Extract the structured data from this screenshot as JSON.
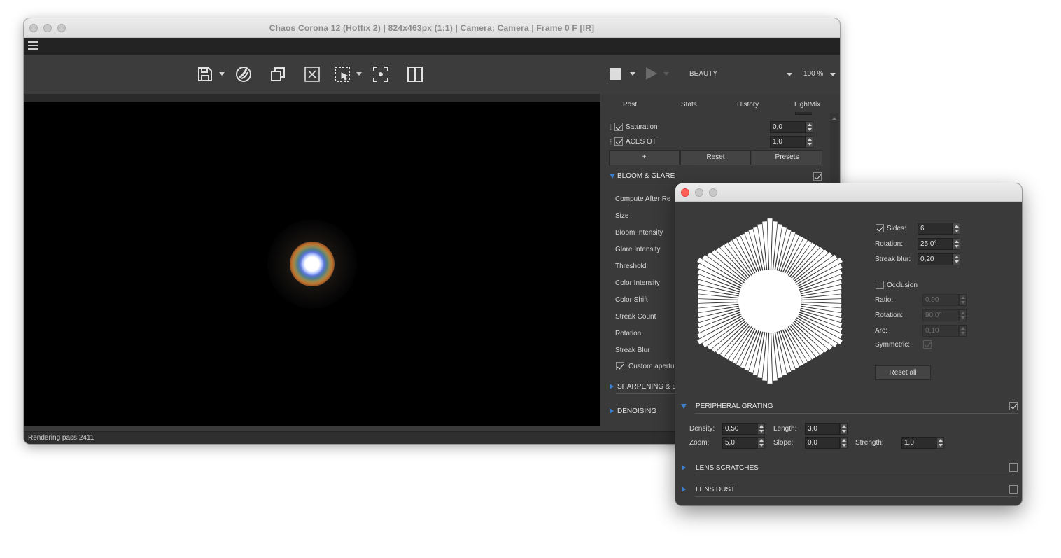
{
  "main_window": {
    "title": "Chaos Corona 12 (Hotfix 2) | 824x463px (1:1) | Camera: Camera | Frame 0 F [IR]",
    "toolbar": {
      "icons": [
        "save-icon",
        "corona-icon",
        "copy-region-icon",
        "clear-icon",
        "region-select-icon",
        "focus-icon",
        "compare-icon",
        "stop-icon",
        "render-icon"
      ],
      "render_pass_selector": "BEAUTY",
      "zoom": "100 %"
    },
    "status": "Rendering pass 2411"
  },
  "panel": {
    "tabs": [
      "Post",
      "Stats",
      "History",
      "LightMix"
    ],
    "active_tab": "Post",
    "operators": [
      {
        "label": "Saturation",
        "value": "0,0",
        "checked": true
      },
      {
        "label": "ACES OT",
        "value": "1,0",
        "checked": true
      }
    ],
    "buttons": {
      "add": "+",
      "reset": "Reset",
      "presets": "Presets"
    },
    "bloom_glare": {
      "header": "BLOOM & GLARE",
      "enabled": true,
      "params": [
        "Compute After Re",
        "Size",
        "Bloom Intensity",
        "Glare Intensity",
        "Threshold",
        "Color Intensity",
        "Color Shift",
        "Streak Count",
        "Rotation",
        "Streak Blur"
      ],
      "custom_aperture_label": "Custom apertu",
      "custom_aperture_checked": true
    },
    "sections_collapsed": [
      "SHARPENING & B",
      "DENOISING"
    ]
  },
  "aperture_dialog": {
    "sides": {
      "label": "Sides:",
      "value": "6",
      "checked": true
    },
    "rotation": {
      "label": "Rotation:",
      "value": "25,0°"
    },
    "streak_blur": {
      "label": "Streak blur:",
      "value": "0,20"
    },
    "occlusion": {
      "label": "Occlusion",
      "checked": false,
      "ratio": {
        "label": "Ratio:",
        "value": "0,90"
      },
      "rotation": {
        "label": "Rotation:",
        "value": "90,0°"
      },
      "arc": {
        "label": "Arc:",
        "value": "0,10"
      },
      "symmetric": {
        "label": "Symmetric:",
        "checked": true
      }
    },
    "reset_all": "Reset all",
    "peripheral_grating": {
      "header": "PERIPHERAL GRATING",
      "enabled": true,
      "density": {
        "label": "Density:",
        "value": "0,50"
      },
      "length": {
        "label": "Length:",
        "value": "3,0"
      },
      "zoom": {
        "label": "Zoom:",
        "value": "5,0"
      },
      "slope": {
        "label": "Slope:",
        "value": "0,0"
      },
      "strength": {
        "label": "Strength:",
        "value": "1,0"
      }
    },
    "lens_scratches": {
      "header": "LENS SCRATCHES",
      "enabled": false
    },
    "lens_dust": {
      "header": "LENS DUST",
      "enabled": false
    }
  },
  "colors": {
    "accent": "#3b7fd0",
    "close_red": "#ff5f57",
    "panel_bg": "#3a3a3a",
    "render_bg": "#000000"
  }
}
